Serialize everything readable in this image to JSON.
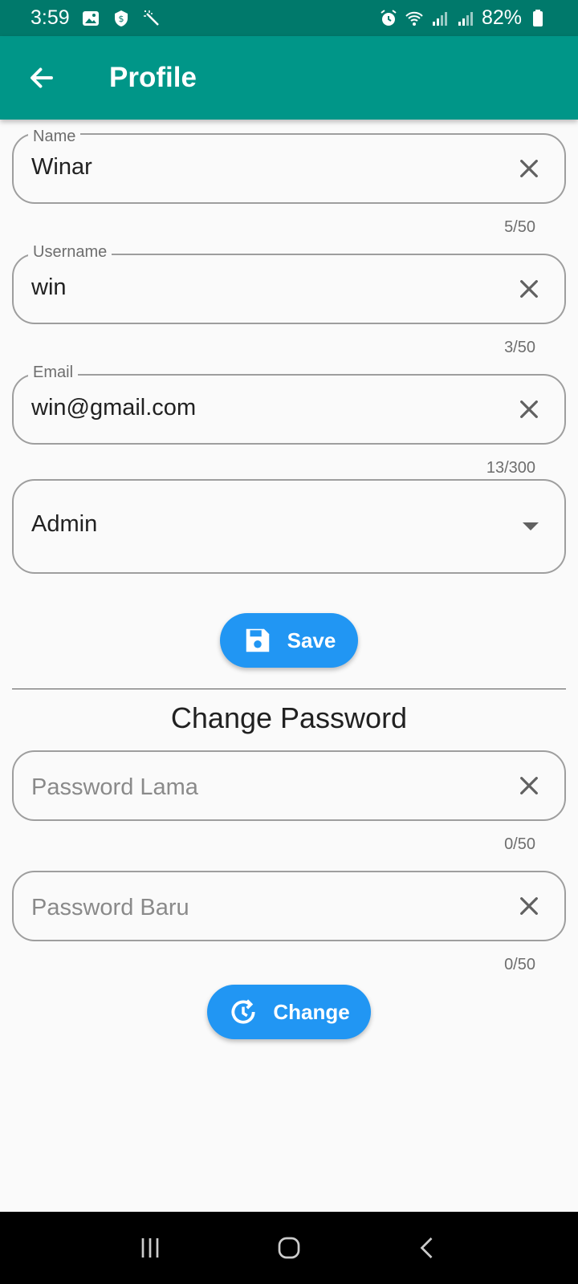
{
  "status_bar": {
    "time": "3:59",
    "battery": "82%"
  },
  "app_bar": {
    "title": "Profile"
  },
  "profile": {
    "name": {
      "label": "Name",
      "value": "Winar",
      "counter": "5/50"
    },
    "username": {
      "label": "Username",
      "value": "win",
      "counter": "3/50"
    },
    "email": {
      "label": "Email",
      "value": "win@gmail.com",
      "counter": "13/300"
    },
    "role": {
      "value": "Admin"
    },
    "save_label": "Save"
  },
  "change_password": {
    "title": "Change Password",
    "old_password": {
      "placeholder": "Password Lama",
      "counter": "0/50"
    },
    "new_password": {
      "placeholder": "Password Baru",
      "counter": "0/50"
    },
    "change_label": "Change"
  },
  "colors": {
    "status_bar": "#00796b",
    "app_bar": "#009688",
    "button": "#2196f3"
  }
}
